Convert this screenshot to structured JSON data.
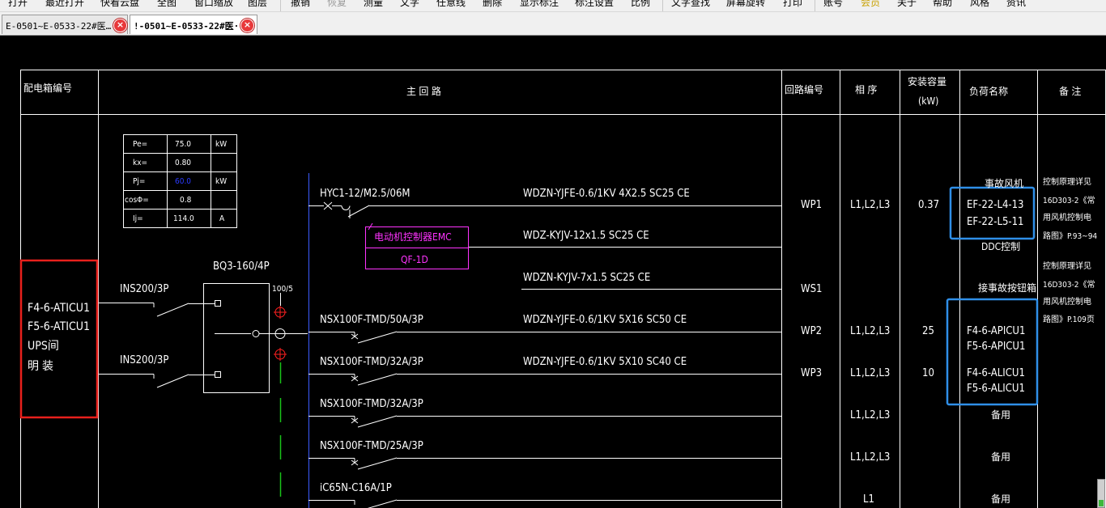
{
  "menu": [
    "打开",
    "最近打开",
    "快看云盘",
    "全图",
    "窗口缩放",
    "图层",
    "撤销",
    "恢复",
    "测量",
    "文字",
    "任意线",
    "删除",
    "显示标注",
    "标注设置",
    "比例",
    "文字查找",
    "屏幕旋转",
    "打印",
    "账号",
    "会员",
    "关于",
    "帮助",
    "风格",
    "资讯"
  ],
  "tabs": [
    {
      "label": "E-0501~E-0533-22#医…",
      "close": "×"
    },
    {
      "label": "!-0501~E-0533-22#医·",
      "close": "×"
    }
  ],
  "table": {
    "headers": {
      "panel_no": "配电箱编号",
      "main_circuit": "主 回 路",
      "circuit_no": "回路编号",
      "phase": "相 序",
      "capacity": "安装容量",
      "capacity_unit": "(kW)",
      "load_name": "负荷名称",
      "remarks": "备 注"
    },
    "params": [
      {
        "label": "Pe=",
        "value": "75.0",
        "unit": "kW"
      },
      {
        "label": "kx=",
        "value": "0.80",
        "unit": ""
      },
      {
        "label": "Pj=",
        "value": "60.0",
        "unit": "kW"
      },
      {
        "label": "cosΦ=",
        "value": "0.8",
        "unit": ""
      },
      {
        "label": "Ij=",
        "value": "114.0",
        "unit": "A"
      }
    ],
    "panel": {
      "line1": "F4-6-ATICU1",
      "line2": "F5-6-ATICU1",
      "line3": "UPS间",
      "line4": "明 装"
    },
    "incoming": [
      {
        "label": "INS200/3P"
      },
      {
        "label": "INS200/3P"
      }
    ],
    "ats": {
      "label": "BQ3-160/4P",
      "ct": "100/5"
    },
    "emc": {
      "line1": "电动机控制器EMC",
      "line2": "QF-1D"
    },
    "circuits": [
      {
        "breaker": "HYC1-12/M2.5/06M",
        "cable": "WDZN-YJFE-0.6/1KV  4X2.5 SC25 CE",
        "circuit": "WP1",
        "phase": "L1,L2,L3",
        "power": "0.37"
      },
      {
        "breaker": "",
        "cable": "WDZ-KYJV-12x1.5  SC25 CE",
        "circuit": "",
        "phase": "",
        "power": ""
      },
      {
        "breaker": "",
        "cable": "WDZN-KYJV-7x1.5 SC25 CE",
        "circuit": "WS1",
        "phase": "",
        "power": ""
      },
      {
        "breaker": "NSX100F-TMD/50A/3P",
        "cable": "WDZN-YJFE-0.6/1KV  5X16 SC50 CE",
        "circuit": "WP2",
        "phase": "L1,L2,L3",
        "power": "25"
      },
      {
        "breaker": "NSX100F-TMD/32A/3P",
        "cable": "WDZN-YJFE-0.6/1KV  5X10 SC40 CE",
        "circuit": "WP3",
        "phase": "L1,L2,L3",
        "power": "10"
      },
      {
        "breaker": "NSX100F-TMD/32A/3P",
        "cable": "",
        "circuit": "",
        "phase": "L1,L2,L3",
        "power": ""
      },
      {
        "breaker": "NSX100F-TMD/25A/3P",
        "cable": "",
        "circuit": "",
        "phase": "L1,L2,L3",
        "power": ""
      },
      {
        "breaker": "iC65N-C16A/1P",
        "cable": "",
        "circuit": "",
        "phase": "L1",
        "power": ""
      }
    ],
    "loads": {
      "fire_fan": "事故风机",
      "ef1": "EF-22-L4-13",
      "ef2": "EF-22-L5-11",
      "ddc": "DDC控制",
      "fire_button": "接事故按钮箱",
      "ap1": "F4-6-APICU1",
      "ap2": "F5-6-APICU1",
      "al1": "F4-6-ALICU1",
      "al2": "F5-6-ALICU1",
      "spare1": "备用",
      "spare2": "备用",
      "spare3": "备用"
    },
    "remarks": {
      "r1_l1": "控制原理详见",
      "r1_l2": "16D303-2《常",
      "r1_l3": "用风机控制电",
      "r1_l4": "路图》P.93~94",
      "r2_l1": "控制原理详见",
      "r2_l2": "16D303-2《常",
      "r2_l3": "用风机控制电",
      "r2_l4": "路图》P.109页"
    }
  },
  "colors": {
    "highlight_red": "#e8201c",
    "highlight_blue": "#2f8fe8",
    "magenta": "#ff33ff",
    "blue_text": "#2b3bff",
    "drawing_line": "#ffffff",
    "bus_blue": "#3c5cff",
    "bus_green": "#19c319",
    "symbol_red": "#ff2020"
  }
}
